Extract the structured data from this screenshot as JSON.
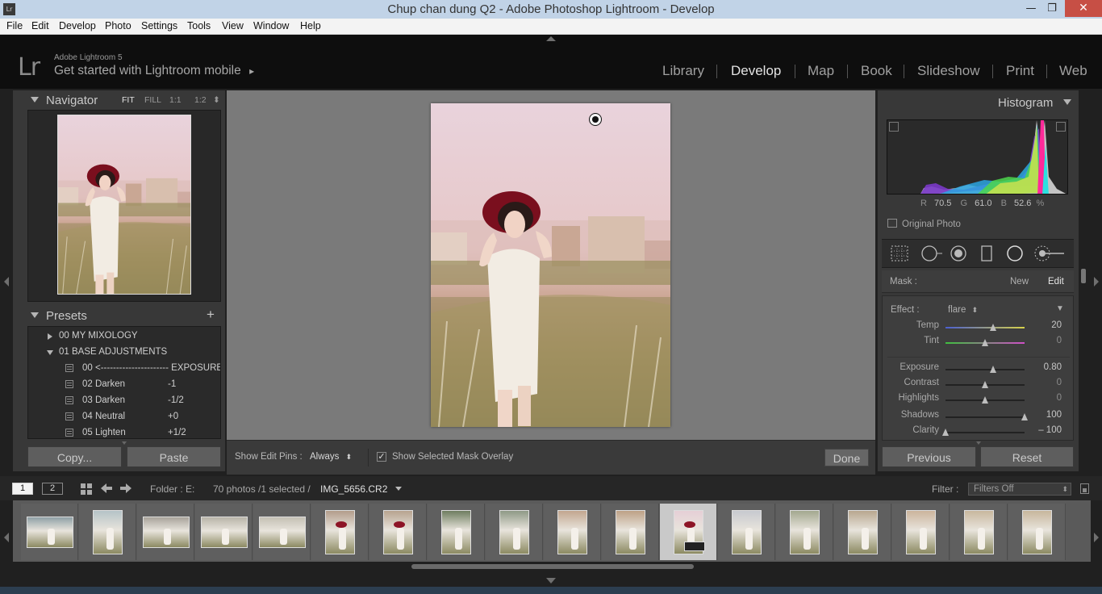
{
  "window": {
    "title": "Chup chan dung Q2 - Adobe Photoshop Lightroom - Develop",
    "app_icon": "Lr",
    "controls": [
      "minimize-icon",
      "restore-icon",
      "close-icon"
    ]
  },
  "menu": [
    "File",
    "Edit",
    "Develop",
    "Photo",
    "Settings",
    "Tools",
    "View",
    "Window",
    "Help"
  ],
  "identity": {
    "logo": "Lr",
    "small": "Adobe Lightroom 5",
    "big": "Get started with Lightroom mobile",
    "arrow": "▸"
  },
  "modules": [
    {
      "label": "Library",
      "active": false
    },
    {
      "label": "Develop",
      "active": true
    },
    {
      "label": "Map",
      "active": false
    },
    {
      "label": "Book",
      "active": false
    },
    {
      "label": "Slideshow",
      "active": false
    },
    {
      "label": "Print",
      "active": false
    },
    {
      "label": "Web",
      "active": false
    }
  ],
  "navigator": {
    "title": "Navigator",
    "modes": [
      "FIT",
      "FILL",
      "1:1",
      "1:2"
    ],
    "active_mode": "FIT",
    "stepper": "⬍"
  },
  "presets": {
    "title": "Presets",
    "add": "+",
    "rows": [
      {
        "name": "00 MY MIXOLOGY",
        "value": "",
        "kind": "folder-collapsed"
      },
      {
        "name": "01 BASE ADJUSTMENTS",
        "value": "",
        "kind": "folder-expanded"
      },
      {
        "name": "00 <---------------------- EXPOSURE",
        "value": "",
        "kind": "preset"
      },
      {
        "name": "02 Darken",
        "value": "-1",
        "kind": "preset"
      },
      {
        "name": "03 Darken",
        "value": "-1/2",
        "kind": "preset"
      },
      {
        "name": "04 Neutral",
        "value": "+0",
        "kind": "preset"
      },
      {
        "name": "05 Lighten",
        "value": "+1/2",
        "kind": "preset"
      }
    ]
  },
  "left_buttons": {
    "copy": "Copy...",
    "paste": "Paste"
  },
  "toolbar": {
    "show_pins_label": "Show Edit Pins :",
    "show_pins_value": "Always",
    "stepper": "⬍",
    "overlay_label": "Show Selected Mask Overlay",
    "overlay_checked": "✓",
    "done": "Done"
  },
  "histogram": {
    "title": "Histogram",
    "r_label": "R",
    "r": "70.5",
    "g_label": "G",
    "g": "61.0",
    "b_label": "B",
    "b": "52.6",
    "unit": "%",
    "original_photo": "Original Photo"
  },
  "tools": [
    "crop-overlay-icon",
    "spot-removal-icon",
    "red-eye-icon",
    "graduated-filter-icon",
    "radial-filter-icon",
    "adjustment-brush-icon"
  ],
  "mask": {
    "label": "Mask :",
    "new": "New",
    "edit": "Edit"
  },
  "effect": {
    "label": "Effect :",
    "value": "flare",
    "stepper": "⬍",
    "menu_arrow": "▼",
    "sliders": [
      {
        "label": "Temp",
        "value": "20",
        "position": 0.6,
        "track": "temp"
      },
      {
        "label": "Tint",
        "value": "0",
        "position": 0.5,
        "track": "tint"
      },
      {
        "label": "Exposure",
        "value": "0.80",
        "position": 0.6,
        "track": "plain"
      },
      {
        "label": "Contrast",
        "value": "0",
        "position": 0.5,
        "track": "plain"
      },
      {
        "label": "Highlights",
        "value": "0",
        "position": 0.5,
        "track": "plain"
      },
      {
        "label": "Shadows",
        "value": "100",
        "position": 1.0,
        "track": "plain"
      },
      {
        "label": "Clarity",
        "value": "– 100",
        "position": 0.0,
        "track": "plain"
      }
    ]
  },
  "right_buttons": {
    "previous": "Previous",
    "reset": "Reset"
  },
  "filmstrip_header": {
    "page1": "1",
    "page2": "2",
    "folder": "Folder : E:",
    "count": "70 photos /1 selected /",
    "filename": "IMG_5656.CR2",
    "filter_label": "Filter :",
    "filter_value": "Filters Off",
    "stepper": "⬍"
  },
  "filmstrip": {
    "selected_index": 11,
    "thumbs": [
      {
        "orientation": "landscape",
        "hat": false,
        "bg": "#8fa0a6"
      },
      {
        "orientation": "portrait",
        "hat": false,
        "bg": "#b5c3c7"
      },
      {
        "orientation": "landscape",
        "hat": false,
        "bg": "#a8a39a"
      },
      {
        "orientation": "landscape",
        "hat": false,
        "bg": "#b8b4a8"
      },
      {
        "orientation": "landscape",
        "hat": false,
        "bg": "#c4c0b4"
      },
      {
        "orientation": "portrait",
        "hat": true,
        "bg": "#b39d8b"
      },
      {
        "orientation": "portrait",
        "hat": true,
        "bg": "#b7a38f"
      },
      {
        "orientation": "portrait",
        "hat": false,
        "bg": "#6e7d5f"
      },
      {
        "orientation": "portrait",
        "hat": false,
        "bg": "#8e9986"
      },
      {
        "orientation": "portrait",
        "hat": false,
        "bg": "#c2a68f"
      },
      {
        "orientation": "portrait",
        "hat": false,
        "bg": "#bda186"
      },
      {
        "orientation": "portrait",
        "hat": true,
        "bg": "#e6cfd6"
      },
      {
        "orientation": "portrait",
        "hat": false,
        "bg": "#c7c9cf"
      },
      {
        "orientation": "portrait",
        "hat": false,
        "bg": "#a3a88f"
      },
      {
        "orientation": "portrait",
        "hat": false,
        "bg": "#b8a78f"
      },
      {
        "orientation": "portrait",
        "hat": false,
        "bg": "#cbb49c"
      },
      {
        "orientation": "portrait",
        "hat": false,
        "bg": "#c8b79e"
      },
      {
        "orientation": "portrait",
        "hat": false,
        "bg": "#c7b69c"
      }
    ]
  },
  "colors": {
    "active_module": "#e3e3e3",
    "inactive_module": "#a0a0a0",
    "panel": "#383838",
    "canvas": "#7a7a7a",
    "photo_sky": "#e6cfd6"
  }
}
